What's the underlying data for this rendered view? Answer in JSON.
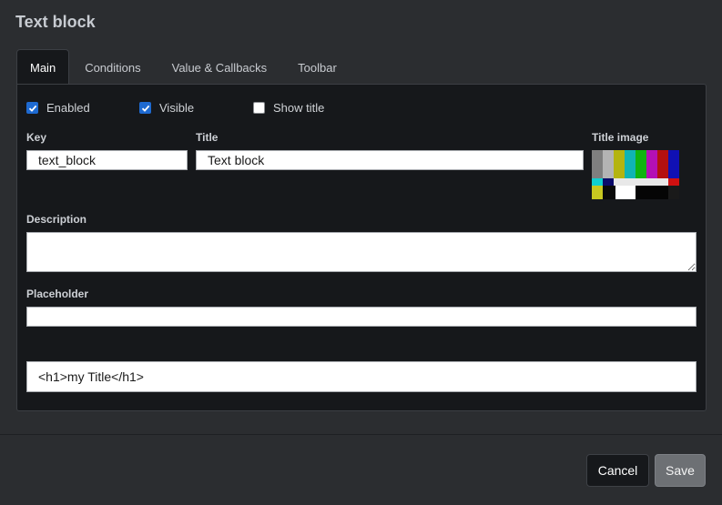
{
  "dialog": {
    "title": "Text block"
  },
  "tabs": [
    {
      "label": "Main",
      "active": true
    },
    {
      "label": "Conditions",
      "active": false
    },
    {
      "label": "Value & Callbacks",
      "active": false
    },
    {
      "label": "Toolbar",
      "active": false
    }
  ],
  "checkboxes": {
    "enabled": {
      "label": "Enabled",
      "checked": true
    },
    "visible": {
      "label": "Visible",
      "checked": true
    },
    "show_title": {
      "label": "Show title",
      "checked": false
    }
  },
  "fields": {
    "key": {
      "label": "Key",
      "value": "text_block"
    },
    "title": {
      "label": "Title",
      "value": "Text block"
    },
    "title_image": {
      "label": "Title image",
      "image": "color-bars-test-pattern"
    },
    "description": {
      "label": "Description",
      "value": ""
    },
    "placeholder": {
      "label": "Placeholder",
      "value": ""
    },
    "html": {
      "value": "<h1>my Title</h1>"
    }
  },
  "buttons": {
    "cancel": "Cancel",
    "save": "Save"
  },
  "colors": {
    "accent": "#1e6ad1",
    "background": "#2b2d30",
    "panel": "#16181b"
  }
}
